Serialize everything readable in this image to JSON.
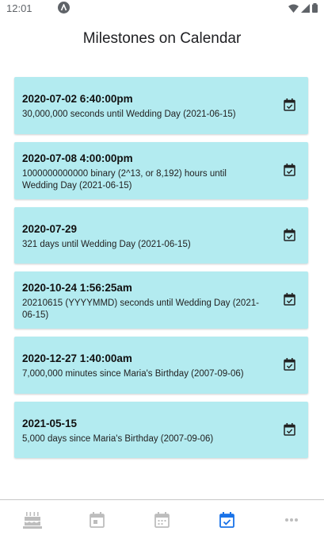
{
  "status": {
    "time": "12:01",
    "app_icon": "a-icon",
    "right_icons": [
      "wifi-icon",
      "signal-icon",
      "battery-icon"
    ]
  },
  "header": {
    "title": "Milestones on Calendar"
  },
  "milestones": [
    {
      "date": "2020-07-02 6:40:00pm",
      "description": "30,000,000 seconds until Wedding Day (2021-06-15)",
      "icon": "calendar-check-icon"
    },
    {
      "date": "2020-07-08 4:00:00pm",
      "description": "1000000000000 binary (2^13, or 8,192) hours until Wedding Day (2021-06-15)",
      "icon": "calendar-check-icon"
    },
    {
      "date": "2020-07-29",
      "description": "321 days until Wedding Day (2021-06-15)",
      "icon": "calendar-check-icon"
    },
    {
      "date": "2020-10-24 1:56:25am",
      "description": "20210615 (YYYYMMD) seconds until Wedding Day (2021-06-15)",
      "icon": "calendar-check-icon"
    },
    {
      "date": "2020-12-27 1:40:00am",
      "description": "7,000,000 minutes since Maria's Birthday (2007-09-06)",
      "icon": "calendar-check-icon"
    },
    {
      "date": "2021-05-15",
      "description": "5,000 days since Maria's Birthday (2007-09-06)",
      "icon": "calendar-check-icon"
    }
  ],
  "bottom_nav": [
    {
      "icon": "cake-icon",
      "active": false
    },
    {
      "icon": "calendar-today-icon",
      "active": false
    },
    {
      "icon": "calendar-month-icon",
      "active": false
    },
    {
      "icon": "calendar-check-icon",
      "active": true
    },
    {
      "icon": "more-horizontal-icon",
      "active": false
    }
  ],
  "colors": {
    "card_background": "#b3ebf0",
    "accent": "#1a73e8",
    "inactive_icon": "#bdbdbd",
    "text": "#202124"
  }
}
